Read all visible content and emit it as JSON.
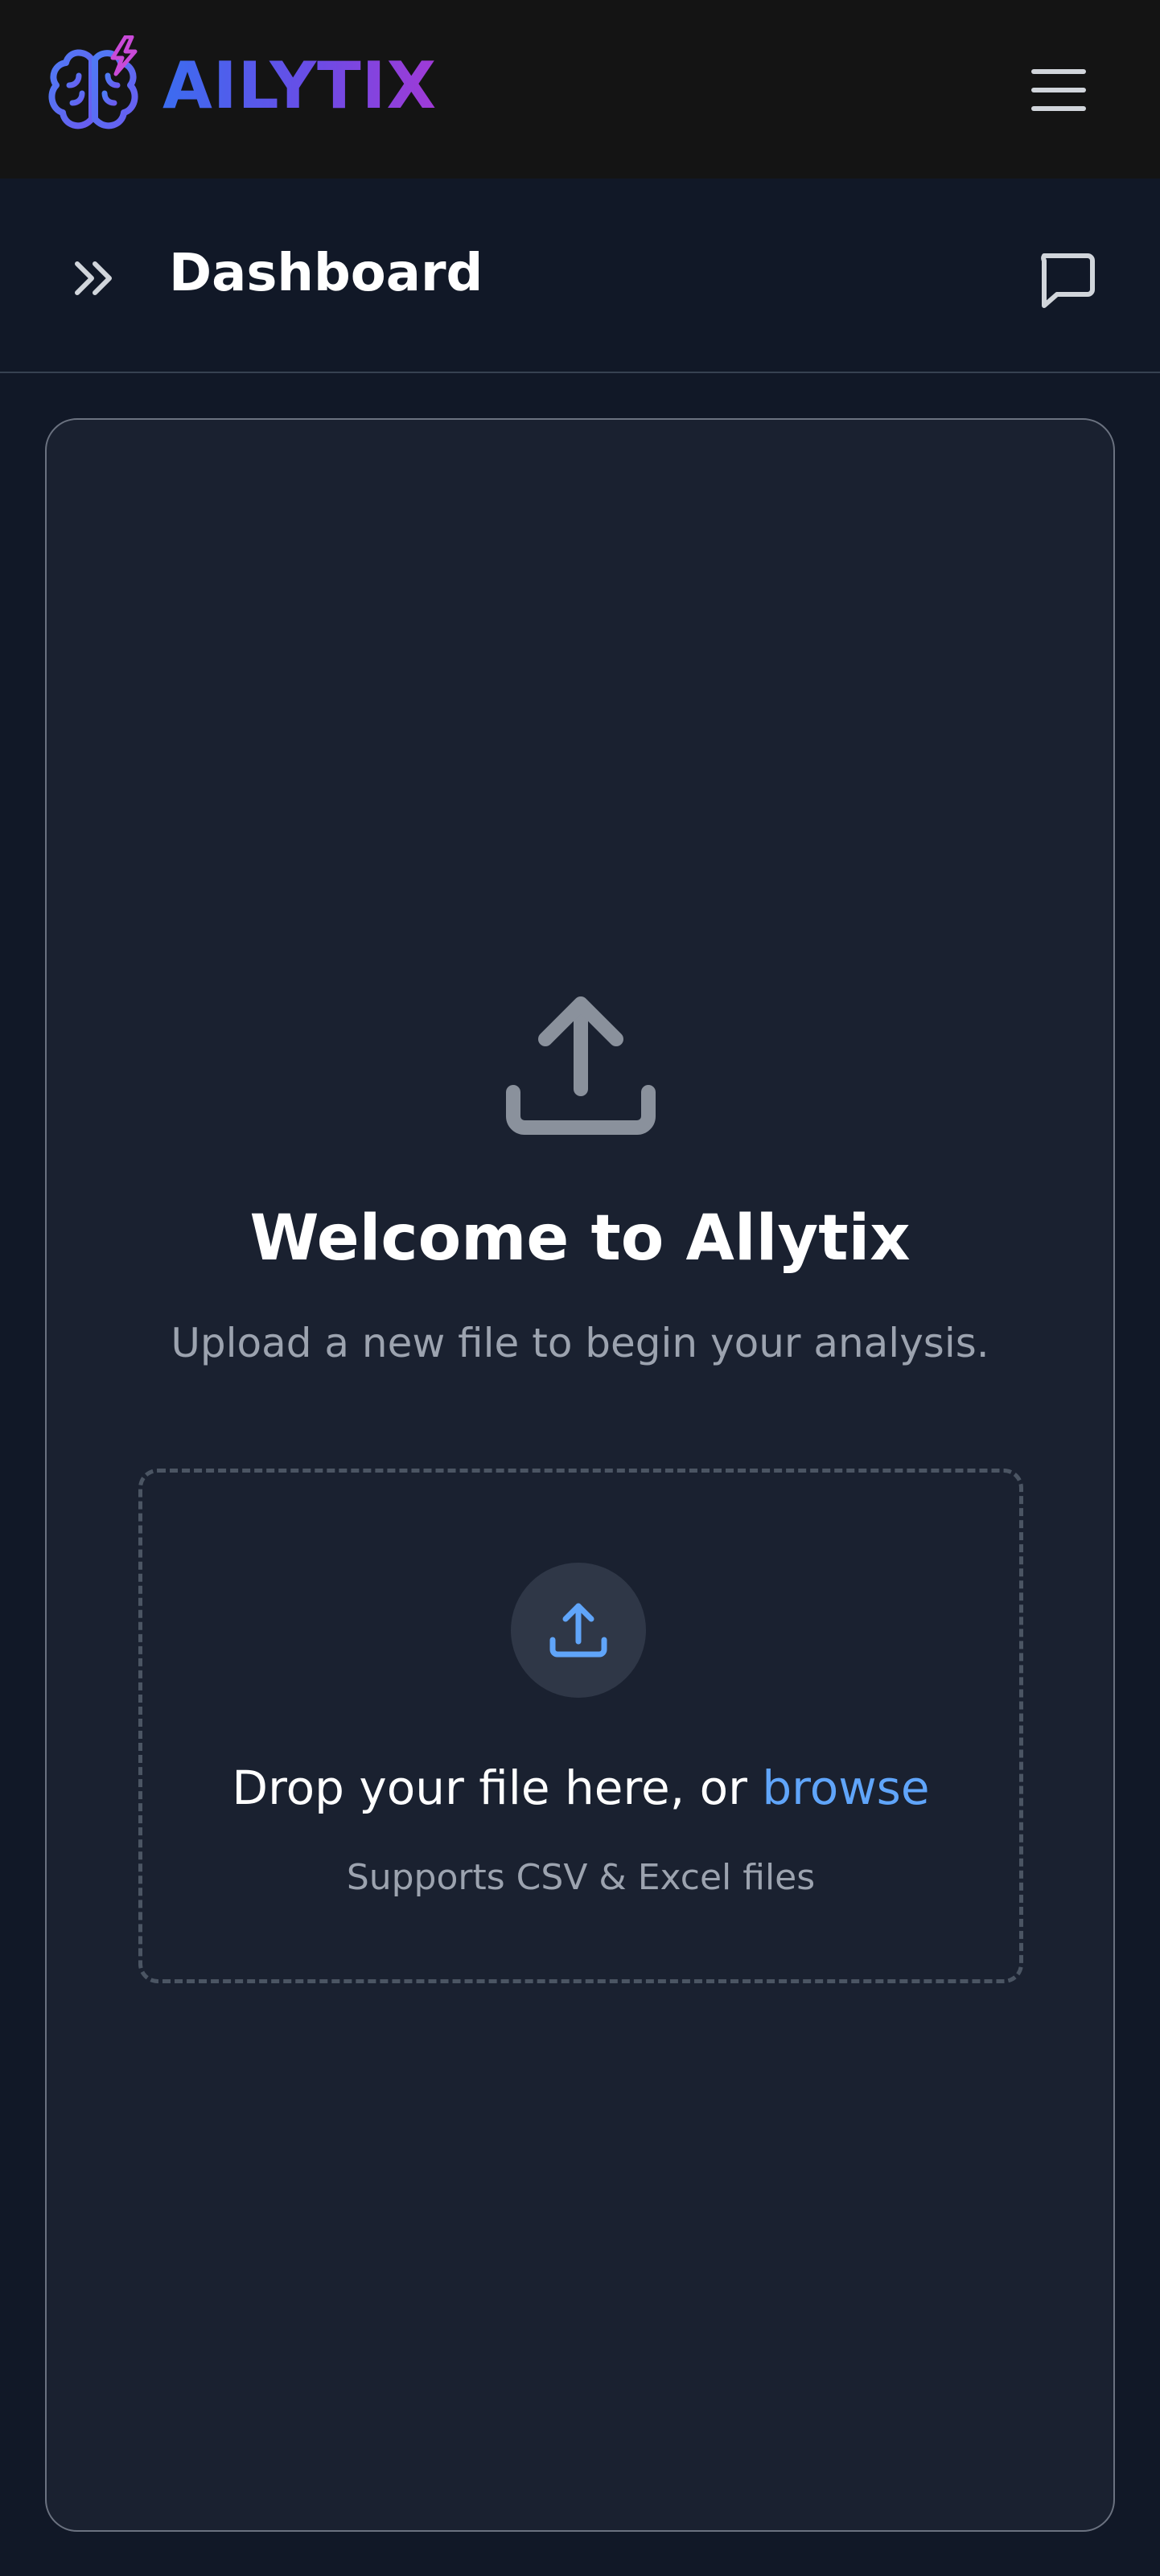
{
  "app": {
    "brand_name": "AILYTIX",
    "brand_colors": [
      "#3b6cf0",
      "#6a4ce6",
      "#a03ad6"
    ]
  },
  "topbar": {
    "logo_icon": "brain-lightning-icon",
    "menu_icon": "hamburger-menu-icon"
  },
  "header": {
    "expand_icon": "chevrons-right-icon",
    "title": "Dashboard",
    "chat_icon": "message-square-icon"
  },
  "main": {
    "hero_icon": "upload-icon",
    "welcome_title": "Welcome to Allytix",
    "welcome_subtitle": "Upload a new file to begin your analysis.",
    "dropzone": {
      "icon": "upload-icon",
      "text_prefix": "Drop your file here, or ",
      "browse_label": "browse",
      "hint": "Supports CSV & Excel files"
    }
  },
  "colors": {
    "background": "#111827",
    "card": "#1a2130",
    "accent": "#60a5fa",
    "muted_text": "#9ca3af"
  }
}
